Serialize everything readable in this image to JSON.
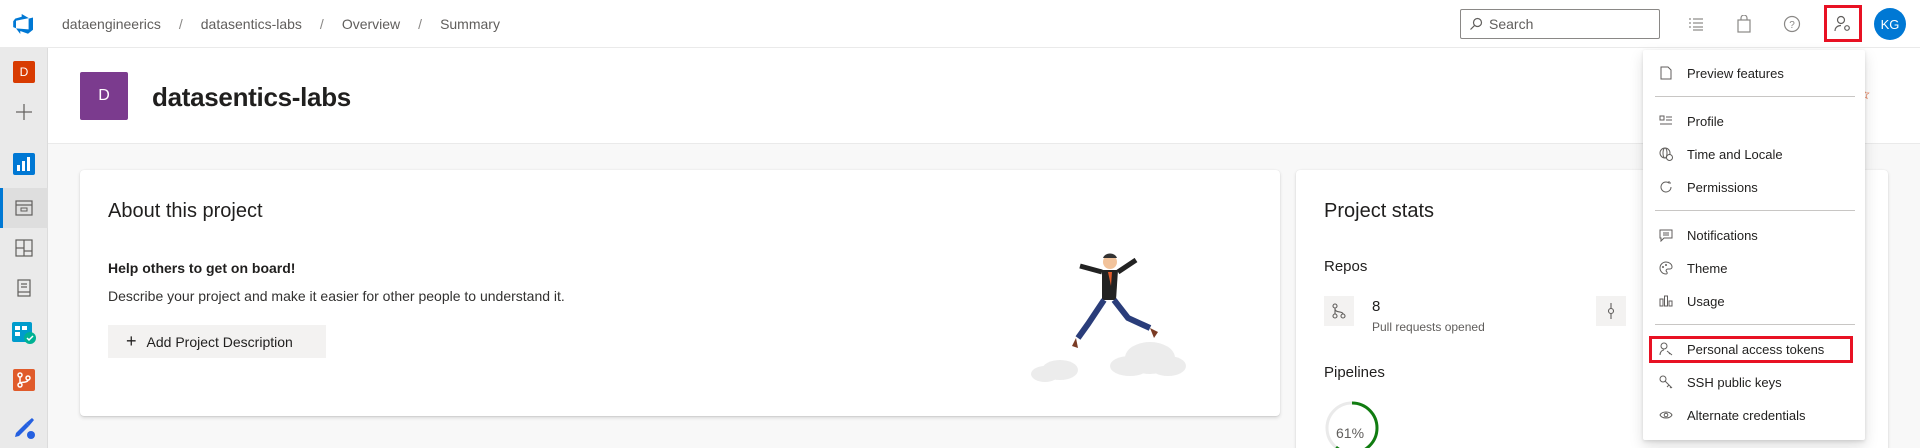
{
  "breadcrumb": {
    "items": [
      "dataengineerics",
      "datasentics-labs",
      "Overview",
      "Summary"
    ],
    "separator": "/"
  },
  "search": {
    "placeholder": "Search"
  },
  "user": {
    "initials": "KG"
  },
  "rail": {
    "project_initial": "D"
  },
  "project": {
    "initial": "D",
    "name": "datasentics-labs"
  },
  "about": {
    "title": "About this project",
    "help_title": "Help others to get on board!",
    "help_desc": "Describe your project and make it easier for other people to understand it.",
    "add_button": "Add Project Description"
  },
  "stats": {
    "title": "Project stats",
    "repos_label": "Repos",
    "pull_requests_count": "8",
    "pull_requests_label": "Pull requests opened",
    "pipelines_label": "Pipelines",
    "pipeline_percent": "61%",
    "pipeline_fraction": 0.61
  },
  "menu": {
    "items": [
      {
        "label": "Preview features",
        "icon": "page-icon"
      },
      {
        "label": "Profile",
        "icon": "profile-card-icon"
      },
      {
        "label": "Time and Locale",
        "icon": "globe-clock-icon"
      },
      {
        "label": "Permissions",
        "icon": "refresh-icon"
      },
      {
        "label": "Notifications",
        "icon": "message-icon"
      },
      {
        "label": "Theme",
        "icon": "palette-icon"
      },
      {
        "label": "Usage",
        "icon": "chart-icon"
      },
      {
        "label": "Personal access tokens",
        "icon": "key-person-icon"
      },
      {
        "label": "SSH public keys",
        "icon": "key-icon"
      },
      {
        "label": "Alternate credentials",
        "icon": "eye-icon"
      }
    ]
  },
  "colors": {
    "accent": "#0078d4",
    "highlight": "#e81123",
    "project_avatar": "#7b3b8e",
    "rail_project": "#d83b01",
    "pipeline_ring": "#107c10"
  }
}
